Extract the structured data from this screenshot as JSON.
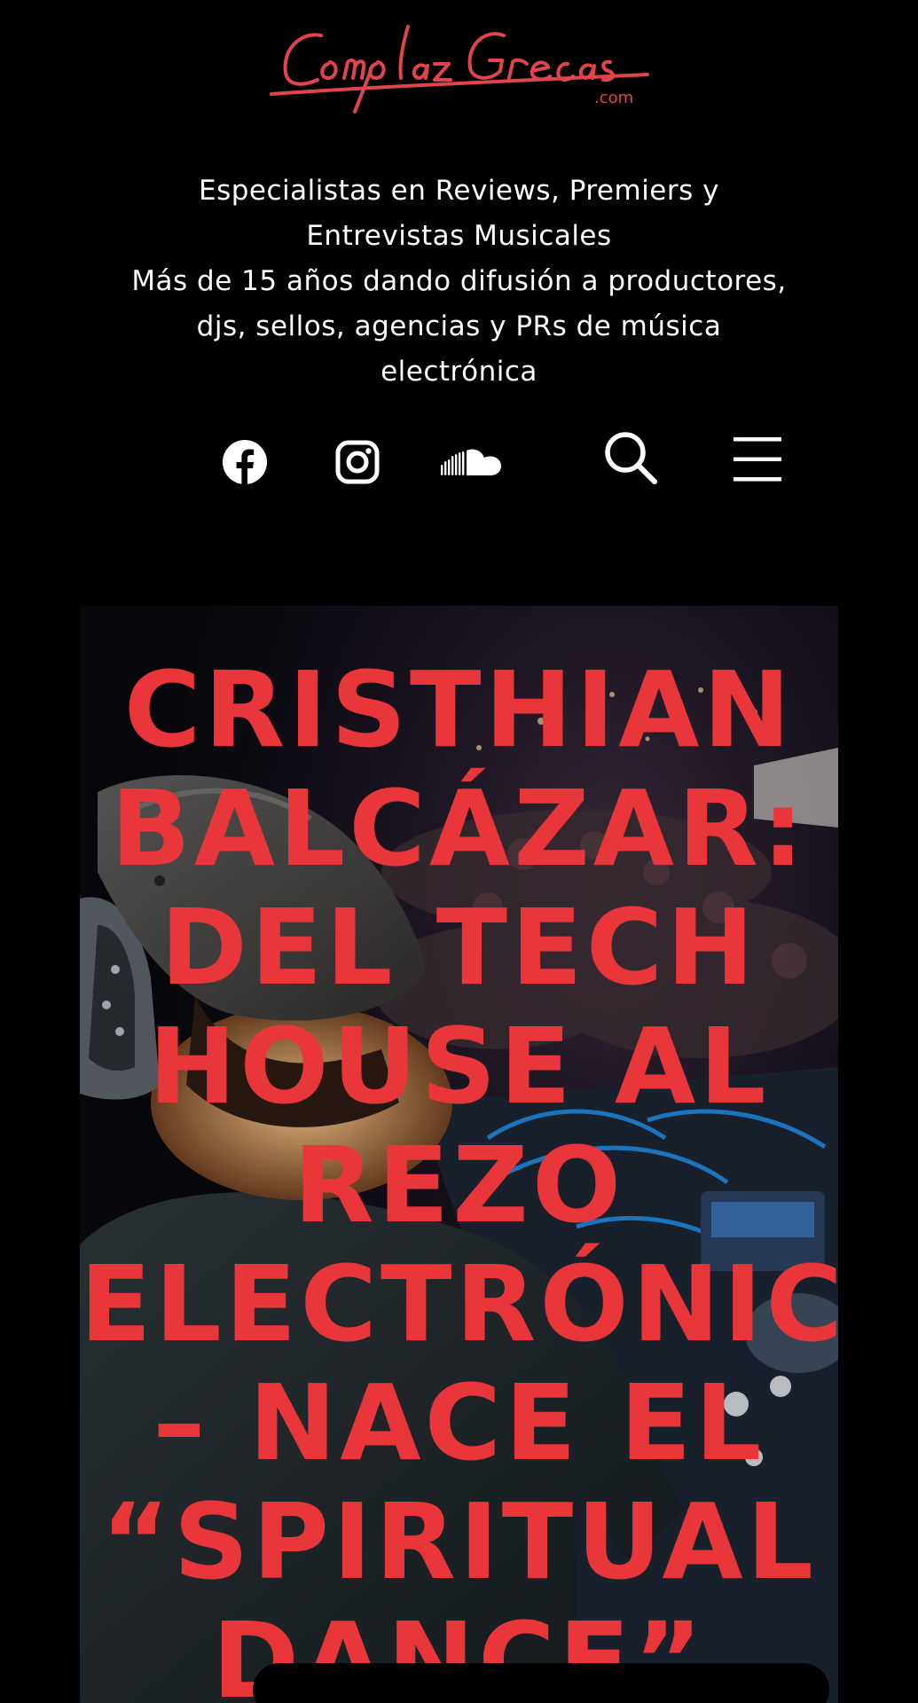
{
  "header": {
    "logo_text": "Como las Grecas",
    "logo_suffix": ".com",
    "tagline": [
      "Especialistas en Reviews, Premiers y",
      "Entrevistas Musicales",
      "Más de 15 años dando difusión a productores,",
      "djs, sellos, agencias y PRs de música",
      "electrónica"
    ]
  },
  "social": {
    "facebook_icon": "facebook-icon",
    "instagram_icon": "instagram-icon",
    "soundcloud_icon": "soundcloud-icon",
    "search_icon": "search-icon",
    "menu_icon": "hamburger-menu-icon"
  },
  "hero": {
    "title_lines": [
      "CRISTHIAN",
      "BALCÁZAR:",
      "DEL TECH",
      "HOUSE AL",
      "REZO",
      "ELECTRÓNICO",
      "– NACE EL",
      "“SPIRITUAL",
      "DANCE”"
    ]
  },
  "colors": {
    "background": "#000000",
    "accent_red": "#e8363a",
    "text_white": "#ffffff"
  }
}
